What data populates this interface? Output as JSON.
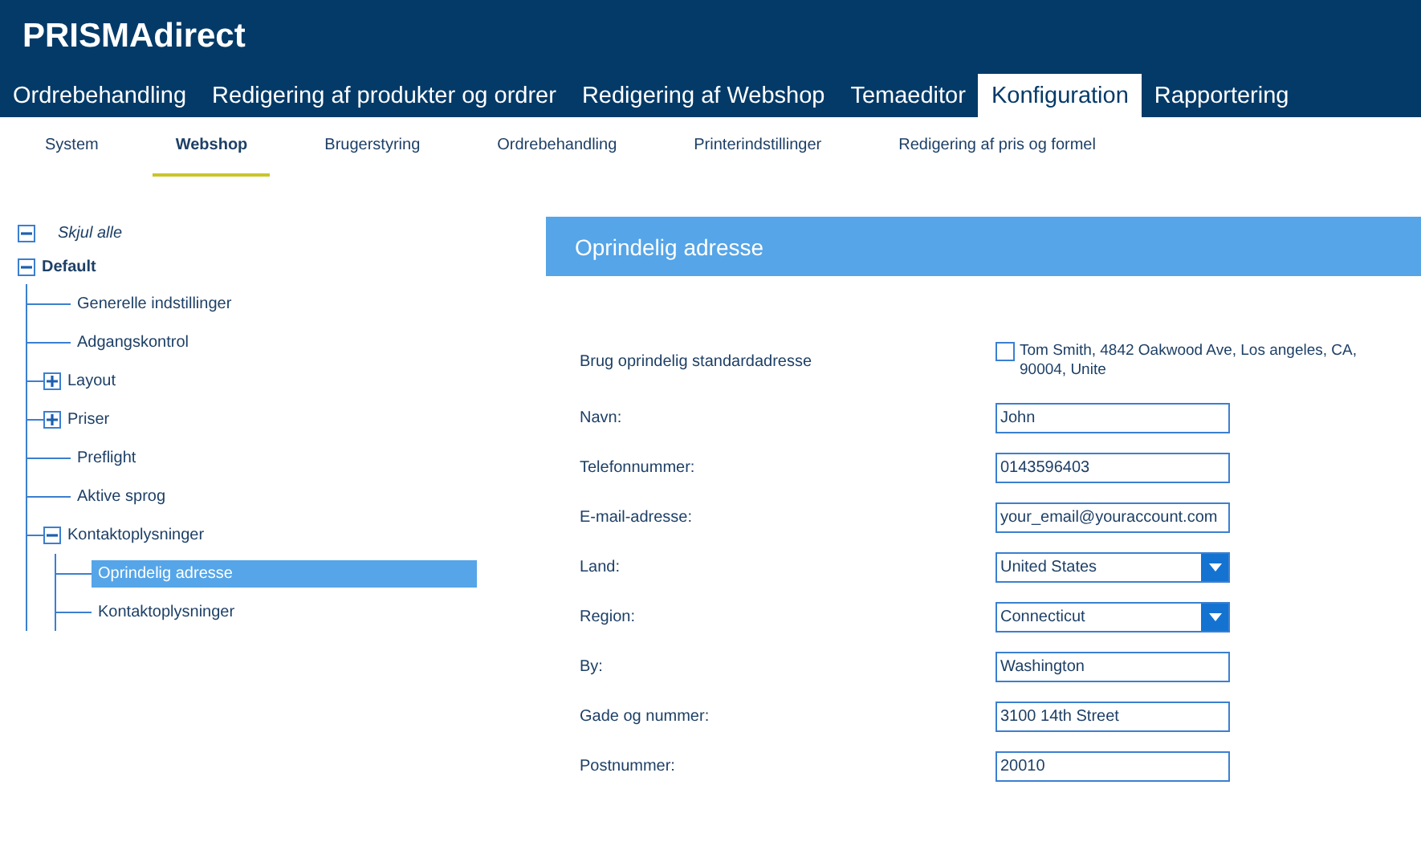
{
  "header": {
    "logo": "PRISMAdirect"
  },
  "main_tabs": [
    {
      "label": "Ordrebehandling",
      "selected": false
    },
    {
      "label": "Redigering af produkter og ordrer",
      "selected": false
    },
    {
      "label": "Redigering af Webshop",
      "selected": false
    },
    {
      "label": "Temaeditor",
      "selected": false
    },
    {
      "label": "Konfiguration",
      "selected": true
    },
    {
      "label": "Rapportering",
      "selected": false
    }
  ],
  "sub_tabs": [
    {
      "label": "System",
      "selected": false
    },
    {
      "label": "Webshop",
      "selected": true
    },
    {
      "label": "Brugerstyring",
      "selected": false
    },
    {
      "label": "Ordrebehandling",
      "selected": false
    },
    {
      "label": "Printerindstillinger",
      "selected": false
    },
    {
      "label": "Redigering af pris og formel",
      "selected": false
    }
  ],
  "tree": {
    "collapse_all": "Skjul alle",
    "root": {
      "label": "Default",
      "expanded": true,
      "children": [
        {
          "label": "Generelle indstillinger",
          "selected": false
        },
        {
          "label": "Adgangskontrol",
          "selected": false
        },
        {
          "label": "Layout",
          "expanded": false,
          "selected": false
        },
        {
          "label": "Priser",
          "expanded": false,
          "selected": false
        },
        {
          "label": "Preflight",
          "selected": false
        },
        {
          "label": "Aktive sprog",
          "selected": false
        },
        {
          "label": "Kontaktoplysninger",
          "expanded": true,
          "selected": false,
          "children": [
            {
              "label": "Oprindelig adresse",
              "selected": true
            },
            {
              "label": "Kontaktoplysninger",
              "selected": false
            }
          ]
        }
      ]
    }
  },
  "panel": {
    "title": "Oprindelig adresse",
    "rows": [
      {
        "kind": "checkbox",
        "label": "Brug oprindelig standardadresse",
        "checked": false,
        "text": "Tom Smith, 4842 Oakwood Ave, Los angeles, CA, 90004, Unite"
      },
      {
        "kind": "text",
        "label": "Navn:",
        "value": "John"
      },
      {
        "kind": "text",
        "label": "Telefonnummer:",
        "value": "0143596403"
      },
      {
        "kind": "text",
        "label": "E-mail-adresse:",
        "value": "your_email@youraccount.com"
      },
      {
        "kind": "select",
        "label": "Land:",
        "value": "United States"
      },
      {
        "kind": "select",
        "label": "Region:",
        "value": "Connecticut"
      },
      {
        "kind": "text",
        "label": "By:",
        "value": "Washington"
      },
      {
        "kind": "text",
        "label": "Gade og nummer:",
        "value": "3100 14th Street"
      },
      {
        "kind": "text",
        "label": "Postnummer:",
        "value": "20010"
      }
    ]
  }
}
